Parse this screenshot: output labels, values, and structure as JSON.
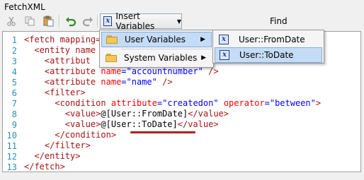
{
  "window": {
    "title": "FetchXML"
  },
  "toolbar": {
    "insert_variables_label": "Insert Variables",
    "find_label": "Find"
  },
  "menu": {
    "items": [
      {
        "label": "User Variables"
      },
      {
        "label": "System Variables"
      }
    ]
  },
  "submenu": {
    "items": [
      {
        "label": "User::FromDate"
      },
      {
        "label": "User::ToDate"
      }
    ]
  },
  "editor": {
    "line_numbers": [
      "1",
      "2",
      "3",
      "4",
      "5",
      "6",
      "7",
      "8",
      "9",
      "10",
      "11",
      "12",
      "13"
    ],
    "lines": {
      "l1_tag": "<fetch mapping=",
      "l2_tag": "<entity name",
      "l3_tag": "<attribut",
      "l4_tag": "<attribute",
      "l4_attr": "name",
      "l4_val": "\"accountnumber\"",
      "l4_end": "/>",
      "l5_tag": "<attribute",
      "l5_attr": "name",
      "l5_val": "\"name\"",
      "l5_end": "/>",
      "l6_tag": "<filter>",
      "l7_tag": "<condition",
      "l7_attr1": "attribute",
      "l7_val1": "\"createdon\"",
      "l7_attr2": "operator",
      "l7_val2": "\"between\"",
      "l7_end": ">",
      "l8_open": "<value>",
      "l8_text": "@[User::FromDate]",
      "l8_close": "</value>",
      "l9_open": "<value>",
      "l9_text": "@[User::ToDate]",
      "l9_close": "</value>",
      "l10_tag": "</condition>",
      "l11_tag": "</filter>",
      "l12_tag": "</entity>",
      "l13_tag": "</fetch>"
    }
  },
  "colors": {
    "highlight": "#c5dcf6",
    "underline": "#b02020"
  }
}
